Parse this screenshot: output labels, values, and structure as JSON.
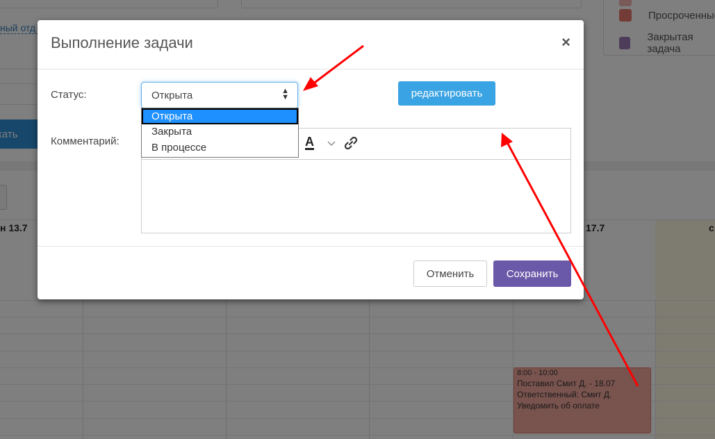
{
  "background": {
    "legend": [
      {
        "label": "Просроченные",
        "color": "#e8796c"
      },
      {
        "label": "Закрытая задача",
        "color": "#9b7bb5"
      }
    ],
    "link_text": "ный отд",
    "blue_button_text": "кать",
    "days": [
      {
        "label": "н 13.7"
      },
      {
        "label": "17.7"
      },
      {
        "label": "с"
      }
    ],
    "event": {
      "time": "8:00 - 10:00",
      "line1": "Поставил Смит Д. - 18.07",
      "line2": "Ответственный: Смит Д.",
      "line3": "Уведомить об оплате",
      "color": "#f2a79c"
    }
  },
  "modal": {
    "title": "Выполнение задачи",
    "close": "×",
    "status_label": "Статус:",
    "status_value": "Открыта",
    "status_options": [
      "Открыта",
      "Закрыта",
      "В процессе"
    ],
    "edit_button": "редактировать",
    "comment_label": "Комментарий:",
    "toolbar": {
      "font_color_icon": "A",
      "chevron_icon": "chevron-down-icon",
      "link_icon": "link-icon"
    },
    "cancel_button": "Отменить",
    "save_button": "Сохранить"
  },
  "colors": {
    "accent_blue": "#3aa3e3",
    "save_purple": "#6a59a8",
    "annotation_red": "#ff0000"
  }
}
